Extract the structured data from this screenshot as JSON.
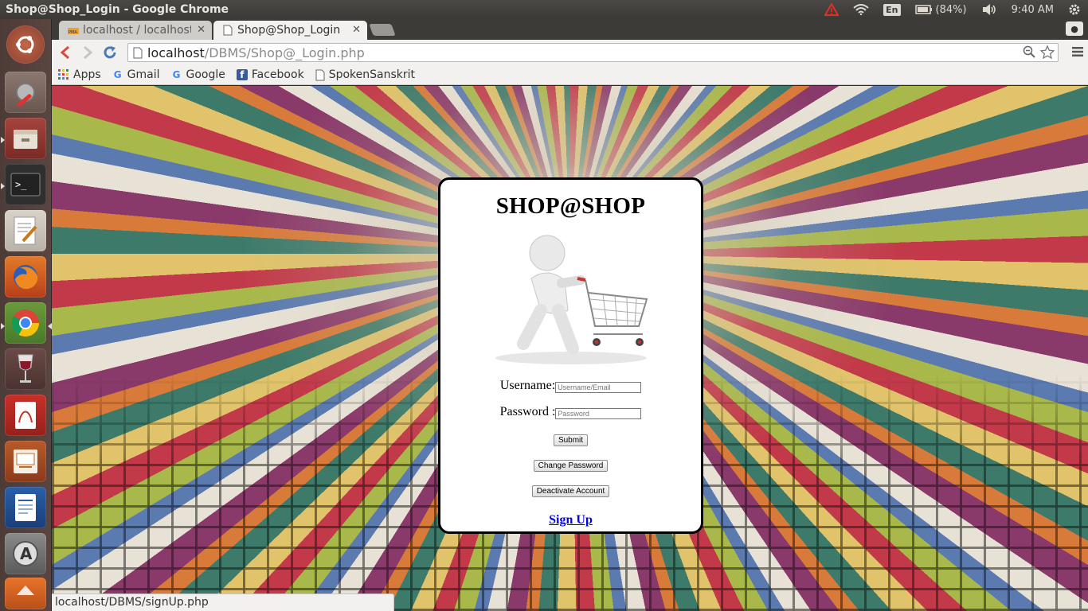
{
  "window": {
    "title": "Shop@Shop_Login - Google Chrome"
  },
  "panel": {
    "lang": "En",
    "battery": "(84%)",
    "time": "9:40 AM"
  },
  "tabs": [
    {
      "label": "localhost / localhost",
      "active": false
    },
    {
      "label": "Shop@Shop_Login",
      "active": true
    }
  ],
  "omnibox": {
    "host": "localhost",
    "path": "/DBMS/Shop@_Login.php"
  },
  "bookmarks": [
    {
      "label": "Apps",
      "icon": "apps-grid-icon"
    },
    {
      "label": "Gmail",
      "icon": "google-g-icon"
    },
    {
      "label": "Google",
      "icon": "google-g-icon"
    },
    {
      "label": "Facebook",
      "icon": "facebook-icon"
    },
    {
      "label": "SpokenSanskrit",
      "icon": "page-icon"
    }
  ],
  "login": {
    "title": "SHOP@SHOP",
    "username_label": "Username:",
    "username_placeholder": "Username/Email",
    "password_label": "Password :",
    "password_placeholder": "Password",
    "submit": "Submit",
    "change_password": "Change Password",
    "deactivate": "Deactivate Account",
    "signup": "Sign Up"
  },
  "status": {
    "url": "localhost/DBMS/signUp.php"
  },
  "colors": {
    "link": "#0000ee",
    "panel_bg": "#3c3b37",
    "launcher_bg": "#553f3b"
  }
}
